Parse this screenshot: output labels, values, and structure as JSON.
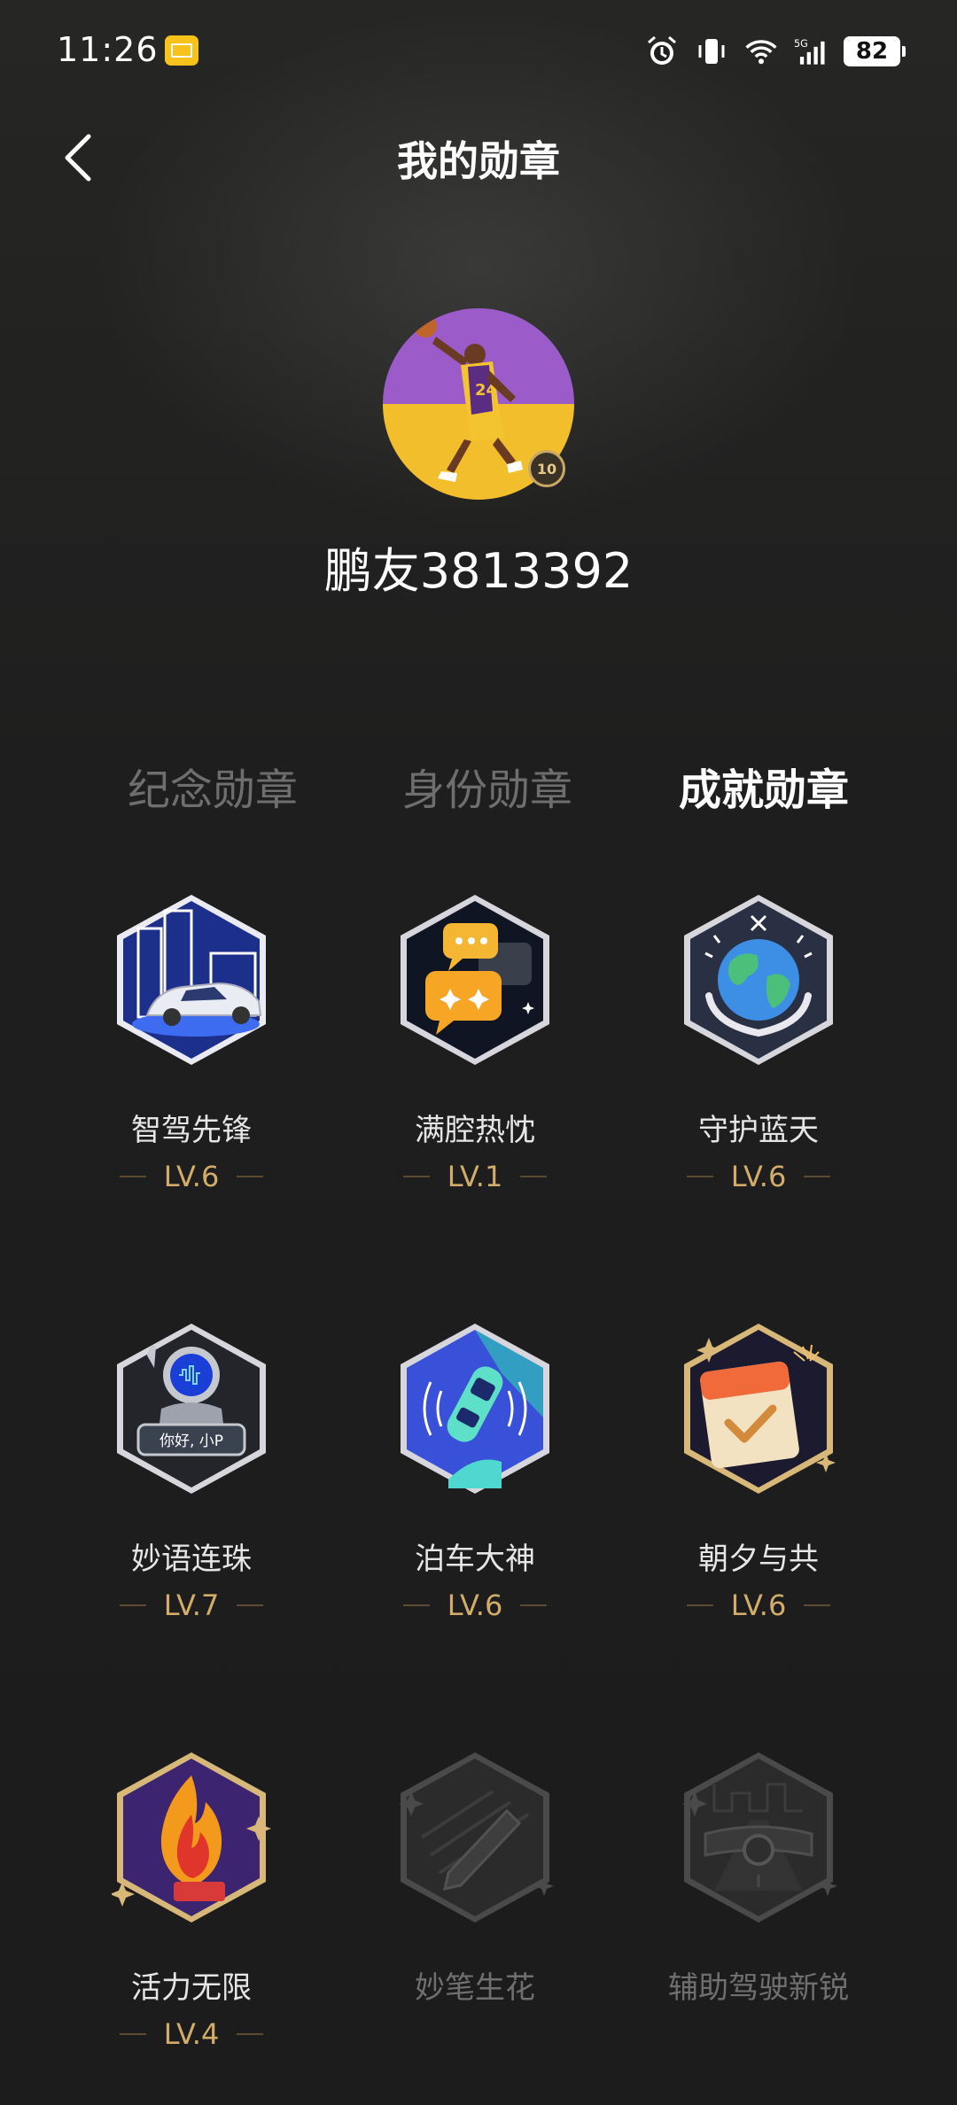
{
  "status_bar": {
    "time": "11:26",
    "battery": "82",
    "icons": [
      "mail-notification-icon",
      "alarm-icon",
      "vibrate-icon",
      "wifi-icon",
      "5g-signal-icon",
      "battery-icon"
    ]
  },
  "header": {
    "title": "我的勋章",
    "back_icon": "chevron-left-icon"
  },
  "profile": {
    "username": "鹏友3813392",
    "avatar_badge_text": "10"
  },
  "tabs": [
    {
      "label": "纪念勋章",
      "active": false
    },
    {
      "label": "身份勋章",
      "active": false
    },
    {
      "label": "成就勋章",
      "active": true
    }
  ],
  "badges": [
    {
      "name": "智驾先锋",
      "level": "LV.6",
      "icon": "city-car-icon",
      "locked": false
    },
    {
      "name": "满腔热忱",
      "level": "LV.1",
      "icon": "chat-bubbles-icon",
      "locked": false
    },
    {
      "name": "守护蓝天",
      "level": "LV.6",
      "icon": "earth-hands-icon",
      "locked": false
    },
    {
      "name": "妙语连珠",
      "level": "LV.7",
      "icon": "voice-assistant-icon",
      "locked": false,
      "icon_text": "你好, 小P"
    },
    {
      "name": "泊车大神",
      "level": "LV.6",
      "icon": "parking-car-icon",
      "locked": false
    },
    {
      "name": "朝夕与共",
      "level": "LV.6",
      "icon": "calendar-check-icon",
      "locked": false
    },
    {
      "name": "活力无限",
      "level": "LV.4",
      "icon": "flame-icon",
      "locked": false
    },
    {
      "name": "妙笔生花",
      "level": "",
      "icon": "pen-icon",
      "locked": true
    },
    {
      "name": "辅助驾驶新锐",
      "level": "",
      "icon": "assisted-driving-icon",
      "locked": true
    }
  ],
  "colors": {
    "background": "#1f1f1f",
    "level_gold": "#d2ad6a",
    "tab_inactive": "#6e6e6e"
  }
}
